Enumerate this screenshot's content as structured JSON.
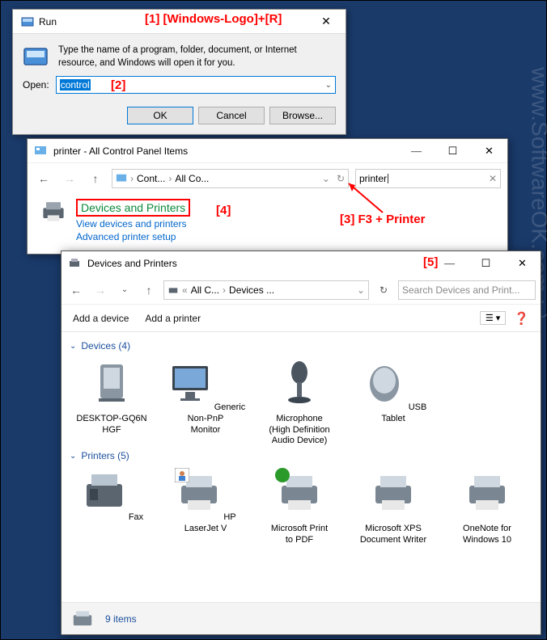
{
  "annotations": {
    "a1": "[1]  [Windows-Logo]+[R]",
    "a2": "[2]",
    "a3": "[3] F3 + Printer",
    "a4": "[4]",
    "a5": "[5]"
  },
  "watermark": "www.SoftwareOK.com  :-)",
  "run": {
    "title": "Run",
    "body": "Type the name of a program, folder, document, or Internet resource, and Windows will open it for you.",
    "open_label": "Open:",
    "value": "control",
    "ok": "OK",
    "cancel": "Cancel",
    "browse": "Browse..."
  },
  "cp": {
    "title": "printer - All Control Panel Items",
    "crumb1": "Cont...",
    "crumb2": "All Co...",
    "search_value": "printer",
    "header": "Devices and Printers",
    "link1": "View devices and printers",
    "link2": "Advanced printer setup"
  },
  "dp": {
    "title": "Devices and Printers",
    "crumb1": "All C...",
    "crumb2": "Devices ...",
    "search_placeholder": "Search Devices and Print...",
    "toolbar": {
      "add_device": "Add a device",
      "add_printer": "Add a printer"
    },
    "groups": {
      "devices": {
        "label": "Devices (4)",
        "items": [
          "DESKTOP-GQ6N\nHGF",
          "Generic Non-PnP\nMonitor",
          "Microphone\n(High Definition\nAudio Device)",
          "USB Tablet"
        ]
      },
      "printers": {
        "label": "Printers (5)",
        "items": [
          "Fax",
          "HP LaserJet V",
          "Microsoft Print\nto PDF",
          "Microsoft XPS\nDocument Writer",
          "OneNote for\nWindows 10"
        ]
      }
    },
    "status": "9 items"
  }
}
